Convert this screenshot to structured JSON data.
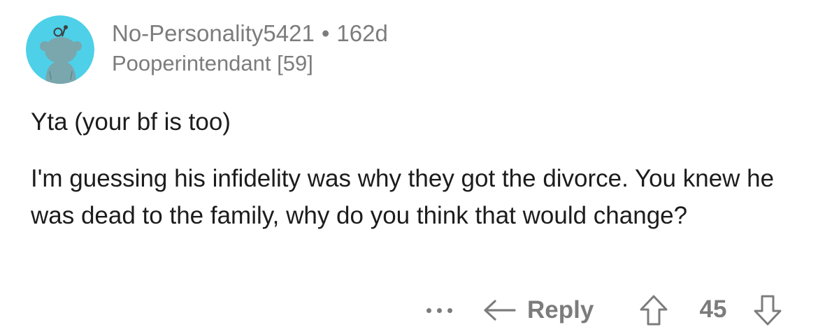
{
  "comment": {
    "author": "No-Personality5421",
    "separator": "•",
    "age": "162d",
    "flair": "Pooperintendant [59]",
    "paragraphs": [
      "Yta (your bf is too)",
      "I'm guessing his infidelity was why they got the divorce. You knew he was dead to the family, why do you think that would change?"
    ]
  },
  "actions": {
    "more_icon": "more-horizontal-icon",
    "reply_icon": "reply-arrow-icon",
    "reply_label": "Reply",
    "upvote_icon": "upvote-arrow-icon",
    "score": "45",
    "downvote_icon": "downvote-arrow-icon"
  },
  "colors": {
    "avatar_bg": "#4DD0E8",
    "muted_text": "#7c7c7c",
    "body_text": "#1c1c1c"
  }
}
